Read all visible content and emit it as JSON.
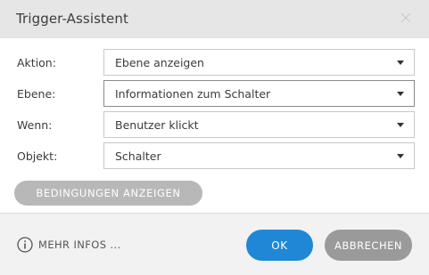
{
  "dialog": {
    "title": "Trigger-Assistent"
  },
  "form": {
    "rows": [
      {
        "label": "Aktion:",
        "value": "Ebene anzeigen"
      },
      {
        "label": "Ebene:",
        "value": "Informationen zum Schalter"
      },
      {
        "label": "Wenn:",
        "value": "Benutzer klickt"
      },
      {
        "label": "Objekt:",
        "value": "Schalter"
      }
    ],
    "conditions_button": "BEDINGUNGEN ANZEIGEN"
  },
  "footer": {
    "more_info": "MEHR INFOS ...",
    "ok": "OK",
    "cancel": "ABBRECHEN"
  },
  "colors": {
    "titlebar": "#e6e6e6",
    "primary": "#1f87d6",
    "secondary_button": "#9a9a9a",
    "conditions_button": "#b8b8b8"
  },
  "icons": {
    "close": "close-icon",
    "dropdown": "chevron-down-icon",
    "info": "info-icon"
  }
}
